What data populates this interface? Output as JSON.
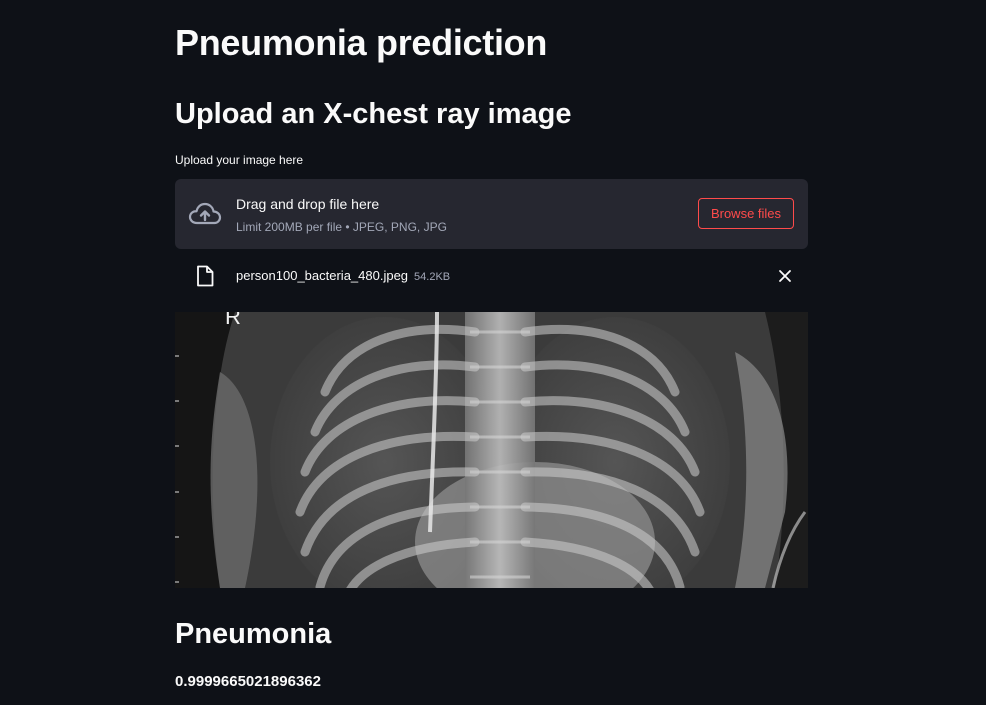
{
  "page": {
    "title": "Pneumonia prediction",
    "subtitle": "Upload an X-chest ray image"
  },
  "uploader": {
    "label": "Upload your image here",
    "drag_text": "Drag and drop file here",
    "limit_text": "Limit 200MB per file • JPEG, PNG, JPG",
    "browse_label": "Browse files",
    "icon": "cloud-upload-icon",
    "accent_color": "#ff4b4b"
  },
  "uploaded_file": {
    "name": "person100_bacteria_480.jpeg",
    "size": "54.2KB",
    "icon": "file-icon",
    "remove_icon": "close-icon"
  },
  "xray_image": {
    "marker": "R"
  },
  "result": {
    "label": "Pneumonia",
    "score": "0.9999665021896362"
  }
}
